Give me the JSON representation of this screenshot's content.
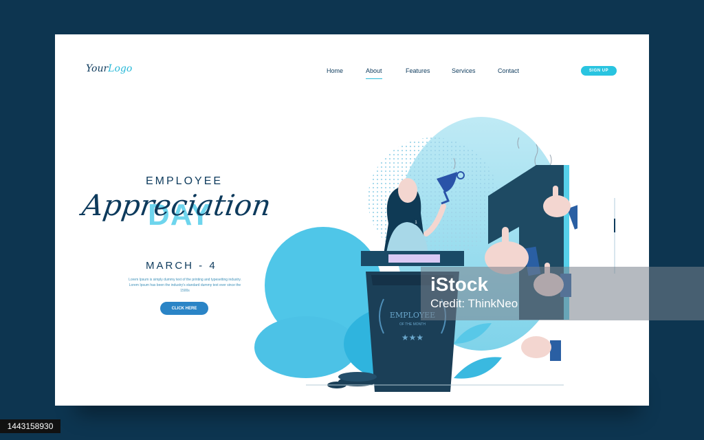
{
  "logo": {
    "part1": "Your",
    "part2": "Logo"
  },
  "nav": [
    "Home",
    "About",
    "Features",
    "Services",
    "Contact"
  ],
  "signup_label": "SIGN UP",
  "hero": {
    "kicker": "EMPLOYEE",
    "script": "Appreciation",
    "day": "DAY",
    "date": "MARCH - 4",
    "description": "Lorem Ipsum is simply dummy text of the printing and typesetting industry. Lorem Ipsum has been the industry's standard dummy text ever since the 1500s",
    "cta": "CLICK HERE"
  },
  "podium": {
    "line1": "EMPLOYEE",
    "line2": "OF THE MONTH"
  },
  "badge_number": "1",
  "watermark": {
    "brand": "iStock",
    "credit": "Credit: ThinkNeo"
  },
  "image_id": "1443158930",
  "colors": {
    "navy": "#0d3a5c",
    "accent": "#29b9d8",
    "cta": "#2a84c6",
    "background": "#0d3550"
  }
}
